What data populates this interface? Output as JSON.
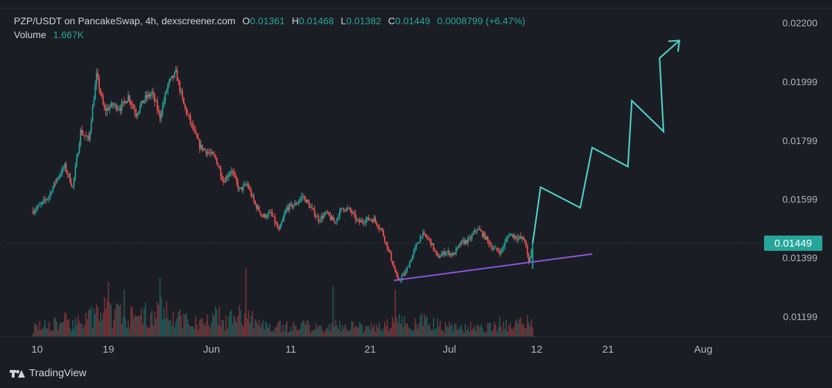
{
  "legend": {
    "symbol": "PZP/USDT on PancakeSwap, 4h, dexscreener.com",
    "o_label": "O",
    "o_value": "0.01361",
    "h_label": "H",
    "h_value": "0.01468",
    "l_label": "L",
    "l_value": "0.01382",
    "c_label": "C",
    "c_value": "0.01449",
    "change": "0.0008799 (+6.47%)",
    "volume_label": "Volume",
    "volume_value": "1.667K"
  },
  "footer": {
    "brand": "TradingView"
  },
  "colors": {
    "background": "#1b1d25",
    "up": "#26a69a",
    "down": "#ef5350",
    "projection": "#4fd1c5",
    "support": "#8c5be0",
    "text": "#d1d4dc",
    "price_tag": "#26a69a"
  },
  "chart_data": {
    "type": "candlestick",
    "title": "PZP/USDT on PancakeSwap, 4h, dexscreener.com",
    "y_ticks": [
      "0.02200",
      "0.01999",
      "0.01799",
      "0.01599",
      "0.01399",
      "0.01199"
    ],
    "ylim": [
      0.0113,
      0.0225
    ],
    "x_ticks": [
      "10",
      "19",
      "Jun",
      "11",
      "21",
      "Jul",
      "12",
      "21",
      "Aug"
    ],
    "x_tick_days": [
      10,
      19,
      32,
      42,
      52,
      62,
      73,
      82,
      94
    ],
    "last_price": "0.01449",
    "price_path": [
      [
        9.5,
        0.0156
      ],
      [
        10.5,
        0.0158
      ],
      [
        11.5,
        0.0161
      ],
      [
        12.5,
        0.0167
      ],
      [
        13.5,
        0.0171
      ],
      [
        14.5,
        0.0164
      ],
      [
        15.5,
        0.0183
      ],
      [
        16.5,
        0.018
      ],
      [
        17.5,
        0.0202
      ],
      [
        18.5,
        0.019
      ],
      [
        19.5,
        0.0192
      ],
      [
        20.5,
        0.0191
      ],
      [
        21.5,
        0.0195
      ],
      [
        22.5,
        0.0189
      ],
      [
        23.5,
        0.0194
      ],
      [
        24.5,
        0.0196
      ],
      [
        25.5,
        0.0188
      ],
      [
        26.5,
        0.0199
      ],
      [
        27.5,
        0.0203
      ],
      [
        28.5,
        0.0192
      ],
      [
        29.5,
        0.0185
      ],
      [
        30.5,
        0.0178
      ],
      [
        31.5,
        0.0176
      ],
      [
        32.5,
        0.0174
      ],
      [
        33.5,
        0.0166
      ],
      [
        34.5,
        0.017
      ],
      [
        35.5,
        0.0163
      ],
      [
        36.5,
        0.0165
      ],
      [
        37.5,
        0.0158
      ],
      [
        38.5,
        0.0154
      ],
      [
        39.5,
        0.0155
      ],
      [
        40.5,
        0.0149
      ],
      [
        41.5,
        0.0157
      ],
      [
        42.5,
        0.0158
      ],
      [
        43.5,
        0.0161
      ],
      [
        44.5,
        0.0157
      ],
      [
        45.5,
        0.0153
      ],
      [
        46.5,
        0.0155
      ],
      [
        47.5,
        0.0152
      ],
      [
        48.5,
        0.0157
      ],
      [
        49.5,
        0.0156
      ],
      [
        50.5,
        0.0152
      ],
      [
        51.5,
        0.0153
      ],
      [
        52.5,
        0.0153
      ],
      [
        53.5,
        0.0149
      ],
      [
        54.5,
        0.0141
      ],
      [
        55.5,
        0.0132
      ],
      [
        56.5,
        0.0135
      ],
      [
        57.5,
        0.0142
      ],
      [
        58.5,
        0.0148
      ],
      [
        59.5,
        0.0146
      ],
      [
        60.5,
        0.014
      ],
      [
        61.5,
        0.0142
      ],
      [
        62.5,
        0.0141
      ],
      [
        63.5,
        0.0145
      ],
      [
        64.5,
        0.0146
      ],
      [
        65.5,
        0.015
      ],
      [
        66.5,
        0.0147
      ],
      [
        67.5,
        0.0143
      ],
      [
        68.5,
        0.0142
      ],
      [
        69.5,
        0.0148
      ],
      [
        70.5,
        0.0147
      ],
      [
        71.5,
        0.0146
      ],
      [
        72.0,
        0.0138
      ],
      [
        72.5,
        0.0145
      ]
    ],
    "volume_path": [
      [
        10.0,
        0.18
      ],
      [
        12.0,
        0.22
      ],
      [
        14.0,
        0.3
      ],
      [
        16.0,
        0.26
      ],
      [
        18.0,
        0.5
      ],
      [
        20.0,
        0.42
      ],
      [
        22.0,
        0.35
      ],
      [
        24.0,
        0.4
      ],
      [
        26.0,
        0.55
      ],
      [
        28.0,
        0.35
      ],
      [
        30.0,
        0.25
      ],
      [
        32.0,
        0.4
      ],
      [
        34.0,
        0.28
      ],
      [
        36.0,
        0.45
      ],
      [
        38.0,
        0.22
      ],
      [
        40.0,
        0.2
      ],
      [
        42.0,
        0.18
      ],
      [
        44.0,
        0.2
      ],
      [
        46.0,
        0.15
      ],
      [
        48.0,
        0.22
      ],
      [
        50.0,
        0.18
      ],
      [
        52.0,
        0.16
      ],
      [
        54.0,
        0.2
      ],
      [
        56.0,
        0.28
      ],
      [
        58.0,
        0.3
      ],
      [
        60.0,
        0.22
      ],
      [
        62.0,
        0.18
      ],
      [
        64.0,
        0.16
      ],
      [
        66.0,
        0.2
      ],
      [
        68.0,
        0.24
      ],
      [
        70.0,
        0.18
      ],
      [
        72.5,
        0.3
      ]
    ],
    "volume_spikes": [
      [
        19.0,
        0.72
      ],
      [
        21.0,
        0.62
      ],
      [
        25.5,
        0.78
      ],
      [
        36.3,
        0.9
      ],
      [
        47.4,
        0.66
      ],
      [
        55.1,
        0.62
      ]
    ],
    "support_line": [
      [
        55.0,
        0.01322
      ],
      [
        80.0,
        0.01412
      ]
    ],
    "projection": [
      [
        72.5,
        0.01449
      ],
      [
        73.5,
        0.0164
      ],
      [
        78.5,
        0.0157
      ],
      [
        80.0,
        0.01775
      ],
      [
        84.5,
        0.0171
      ],
      [
        85.0,
        0.01935
      ],
      [
        89.0,
        0.0183
      ],
      [
        88.5,
        0.0208
      ],
      [
        91.0,
        0.0214
      ]
    ]
  }
}
